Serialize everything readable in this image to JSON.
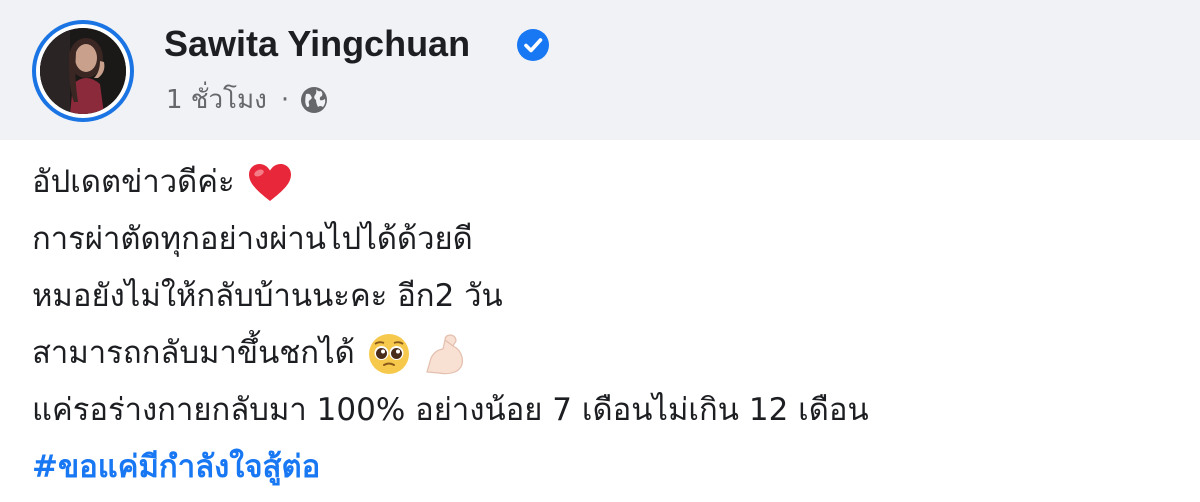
{
  "post_header": {
    "author_name": "Sawita Yingchuan",
    "timestamp": "1 ชั่วโมง",
    "separator": "·",
    "audience_icon": "globe-icon",
    "verified_icon": "verified-badge-icon",
    "accent_color": "#1877f2"
  },
  "post_body": {
    "lines": [
      "อัปเดตข่าวดีค่ะ",
      "การผ่าตัดทุกอย่างผ่านไปได้ด้วยดี",
      "หมอยังไม่ให้กลับบ้านนะคะ อีก2 วัน",
      "สามารถกลับมาขึ้นชกได้",
      "แค่รอร่างกายกลับมา 100%  อย่างน้อย 7 เดือนไม่เกิน 12 เดือน"
    ],
    "hashtag": "#ขอแค่มีกำลังใจสู้ต่อ",
    "emoji_icons": [
      "red-heart-icon",
      "pleading-face-icon",
      "flexed-biceps-icon"
    ]
  }
}
